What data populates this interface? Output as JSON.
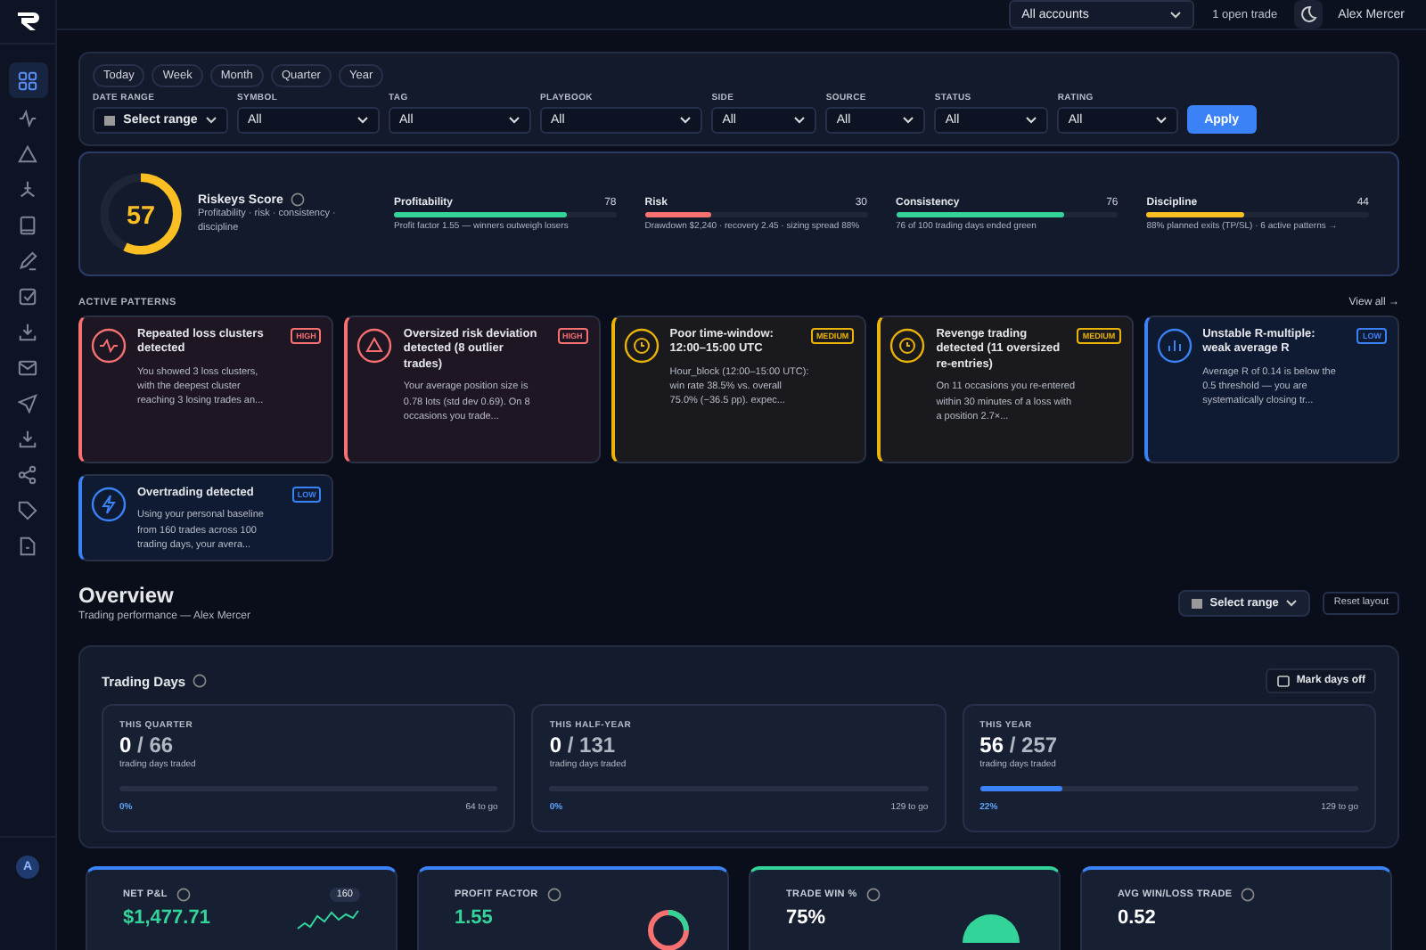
{
  "sidebar": {
    "items": [
      {
        "selected": true
      },
      {
        "selected": false
      },
      {
        "selected": false
      },
      {
        "selected": false
      },
      {
        "selected": false
      },
      {
        "selected": false
      },
      {
        "selected": false
      },
      {
        "selected": false
      },
      {
        "selected": false
      },
      {
        "selected": false
      },
      {
        "selected": false
      },
      {
        "selected": false
      },
      {
        "selected": false
      },
      {
        "selected": false
      }
    ],
    "avatar": "A"
  },
  "topbar": {
    "account_select": "All accounts",
    "open_trades": "1 open trade",
    "user": "Alex Mercer"
  },
  "filters": {
    "presets": [
      {
        "label": "Today",
        "selected": false
      },
      {
        "label": "Week",
        "selected": false
      },
      {
        "label": "Month",
        "selected": false
      },
      {
        "label": "Quarter",
        "selected": false
      },
      {
        "label": "Year",
        "selected": false
      }
    ],
    "date_range": {
      "label": "DATE RANGE",
      "value": "Select range"
    },
    "selects": [
      {
        "label": "SYMBOL",
        "value": "All"
      },
      {
        "label": "TAG",
        "value": "All"
      },
      {
        "label": "PLAYBOOK",
        "value": "All"
      },
      {
        "label": "SIDE",
        "value": "All"
      },
      {
        "label": "SOURCE",
        "value": "All"
      },
      {
        "label": "STATUS",
        "value": "All"
      },
      {
        "label": "RATING",
        "value": "All"
      }
    ],
    "apply": "Apply"
  },
  "score": {
    "value": "57",
    "level": 0.57,
    "title": "Riskeys Score",
    "subtitle": "Profitability · risk · consistency · discipline",
    "metrics": [
      {
        "name": "Profitability",
        "value": "78",
        "level": 0.78,
        "color": "#34d399",
        "note": "Profit factor 1.55 — winners outweigh losers"
      },
      {
        "name": "Risk",
        "value": "30",
        "level": 0.3,
        "color": "#f87171",
        "note": "Drawdown $2,240 · recovery 2.45 · sizing spread 88%"
      },
      {
        "name": "Consistency",
        "value": "76",
        "level": 0.76,
        "color": "#34d399",
        "note": "76 of 100 trading days ended green"
      },
      {
        "name": "Discipline",
        "value": "44",
        "level": 0.44,
        "color": "#fbbf24",
        "note": "88% planned exits (TP/SL) · 6 active patterns →"
      }
    ]
  },
  "patterns": {
    "title": "ACTIVE PATTERNS",
    "view_all": "View all →",
    "items": [
      {
        "severity": "HIGH",
        "title": "Repeated loss clusters detected",
        "text": "You showed 3 loss clusters, with the deepest cluster reaching 3 losing trades an..."
      },
      {
        "severity": "HIGH",
        "title": "Oversized risk deviation detected (8 outlier trades)",
        "text": "Your average position size is 0.78 lots (std dev 0.69). On 8 occasions you trade..."
      },
      {
        "severity": "MEDIUM",
        "title": "Poor time-window: 12:00–15:00 UTC",
        "text": "Hour_block (12:00–15:00 UTC): win rate 38.5% vs. overall 75.0% (−36.5 pp). expec..."
      },
      {
        "severity": "MEDIUM",
        "title": "Revenge trading detected (11 oversized re-entries)",
        "text": "On 11 occasions you re-entered within 30 minutes of a loss with a position 2.7×..."
      },
      {
        "severity": "LOW",
        "title": "Unstable R-multiple: weak average R",
        "text": "Average R of 0.14 is below the 0.5 threshold — you are systematically closing tr..."
      },
      {
        "severity": "LOW",
        "title": "Overtrading detected",
        "text": "Using your personal baseline from 160 trades across 100 trading days, your avera..."
      }
    ]
  },
  "overview": {
    "title": "Overview",
    "subtitle": "Trading performance — Alex Mercer",
    "range_button": "Select range",
    "reset_button": "Reset layout"
  },
  "trading_days": {
    "title": "Trading Days",
    "mark_button": "Mark days off",
    "periods": [
      {
        "label": "THIS QUARTER",
        "done": "0",
        "total": "/ 66",
        "caption": "trading days traded",
        "level": 0,
        "percent": "0%",
        "remaining": "64 to go"
      },
      {
        "label": "THIS HALF-YEAR",
        "done": "0",
        "total": "/ 131",
        "caption": "trading days traded",
        "level": 0,
        "percent": "0%",
        "remaining": "129 to go"
      },
      {
        "label": "THIS YEAR",
        "done": "56",
        "total": "/ 257",
        "caption": "trading days traded",
        "level": 0.22,
        "percent": "22%",
        "remaining": "129 to go"
      }
    ]
  },
  "stat_cards": [
    {
      "kind": "sparkline",
      "title": "NET P&L",
      "badge": "160",
      "value": "$1,477.71",
      "color": "#3b82f6"
    },
    {
      "kind": "ring",
      "title": "PROFIT FACTOR",
      "value": "1.55",
      "color": "#3b82f6"
    },
    {
      "kind": "gauge",
      "title": "TRADE WIN %",
      "value": "75%",
      "color": "#34d399"
    },
    {
      "kind": "plain",
      "title": "AVG WIN/LOSS TRADE",
      "value": "0.52",
      "color": "#3b82f6"
    }
  ]
}
